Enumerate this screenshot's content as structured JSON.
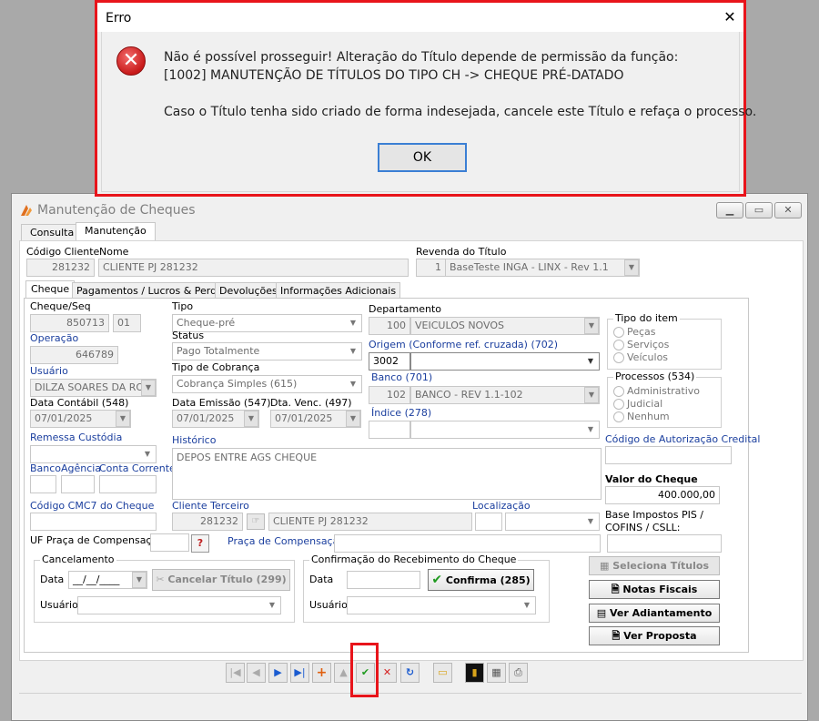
{
  "window": {
    "title": "Manutenção de Cheques"
  },
  "tabs_top": [
    "Consulta",
    "Manutenção"
  ],
  "header": {
    "codigo_cliente_label": "Código Cliente",
    "codigo_cliente": "281232",
    "nome_label": "Nome",
    "nome": "CLIENTE PJ 281232",
    "revenda_label": "Revenda do Título",
    "revenda_num": "1",
    "revenda": "BaseTeste INGA - LINX - Rev 1.1"
  },
  "tabs_inner": [
    "Cheque",
    "Pagamentos / Lucros & Perdas",
    "Devoluções",
    "Informações Adicionais"
  ],
  "form": {
    "cheque_seq_label": "Cheque/Seq",
    "cheque": "850713",
    "seq": "01",
    "tipo_label": "Tipo",
    "tipo": "Cheque-pré",
    "departamento_label": "Departamento",
    "departamento_num": "100",
    "departamento": "VEICULOS NOVOS",
    "operacao_label": "Operação",
    "operacao": "646789",
    "status_label": "Status",
    "status": "Pago Totalmente",
    "origem_label": "Origem (Conforme ref. cruzada) (702)",
    "origem_num": "3002",
    "usuario_label": "Usuário",
    "usuario": "DILZA SOARES DA ROC",
    "tipo_cobranca_label": "Tipo de Cobrança",
    "tipo_cobranca": "Cobrança Simples (615)",
    "banco701_label": "Banco (701)",
    "banco701_num": "102",
    "banco701": "BANCO - REV 1.1-102",
    "data_contabil_label": "Data Contábil (548)",
    "data_contabil": "07/01/2025",
    "data_emissao_label": "Data Emissão (547)",
    "data_emissao": "07/01/2025",
    "dta_venc_label": "Dta. Venc. (497)",
    "dta_venc": "07/01/2025",
    "indice_label": "Índice (278)",
    "remessa_label": "Remessa Custódia",
    "historico_label": "Histórico",
    "historico": "DEPOS ENTRE AGS CHEQUE",
    "banco_label": "Banco",
    "agencia_label": "Agência",
    "conta_label": "Conta Corrente",
    "cmc7_label": "Código CMC7 do Cheque",
    "cliente_terceiro_label": "Cliente Terceiro",
    "cliente_terceiro_num": "281232",
    "cliente_terceiro": "CLIENTE PJ 281232",
    "localizacao_label": "Localização",
    "uf_praca_label": "UF Praça de Compensação",
    "praca_label": "Praça de Compensação",
    "help_icon_text": "?",
    "tipo_item_label": "Tipo do item",
    "tipo_item_options": [
      "Peças",
      "Serviços",
      "Veículos"
    ],
    "processos_label": "Processos (534)",
    "processos_options": [
      "Administrativo",
      "Judicial",
      "Nenhum"
    ],
    "cod_autorizacao_label": "Código de Autorização Credital",
    "valor_cheque_label": "Valor do Cheque",
    "valor_cheque": "400.000,00",
    "base_impostos_label_1": "Base Impostos PIS /",
    "base_impostos_label_2": "COFINS / CSLL:"
  },
  "cancelamento": {
    "legend": "Cancelamento",
    "data_label": "Data",
    "data_value": "__/__/____",
    "usuario_label": "Usuário",
    "button": "Cancelar Título (299)"
  },
  "confirmacao": {
    "legend": "Confirmação do Recebimento do Cheque",
    "data_label": "Data",
    "usuario_label": "Usuário",
    "button": "Confirma (285)"
  },
  "side_buttons": {
    "seleciona": "Seleciona Títulos",
    "notas": "Notas Fiscais",
    "adiantamento": "Ver Adiantamento",
    "proposta": "Ver Proposta"
  },
  "dialog": {
    "title": "Erro",
    "close": "✕",
    "line1": "Não é possível prosseguir! Alteração do Título depende de permissão da função:",
    "line2": "[1002] MANUTENÇÃO DE TÍTULOS DO TIPO CH -> CHEQUE PRÉ-DATADO",
    "line3": "Caso o Título tenha sido criado de forma indesejada, cancele este Título e refaça o processo.",
    "ok": "OK"
  },
  "colors": {
    "highlight_red": "#e8141b",
    "link_blue": "#1a3e9e",
    "confirm_green": "#1f9a1f",
    "cancel_red": "#d42020"
  }
}
